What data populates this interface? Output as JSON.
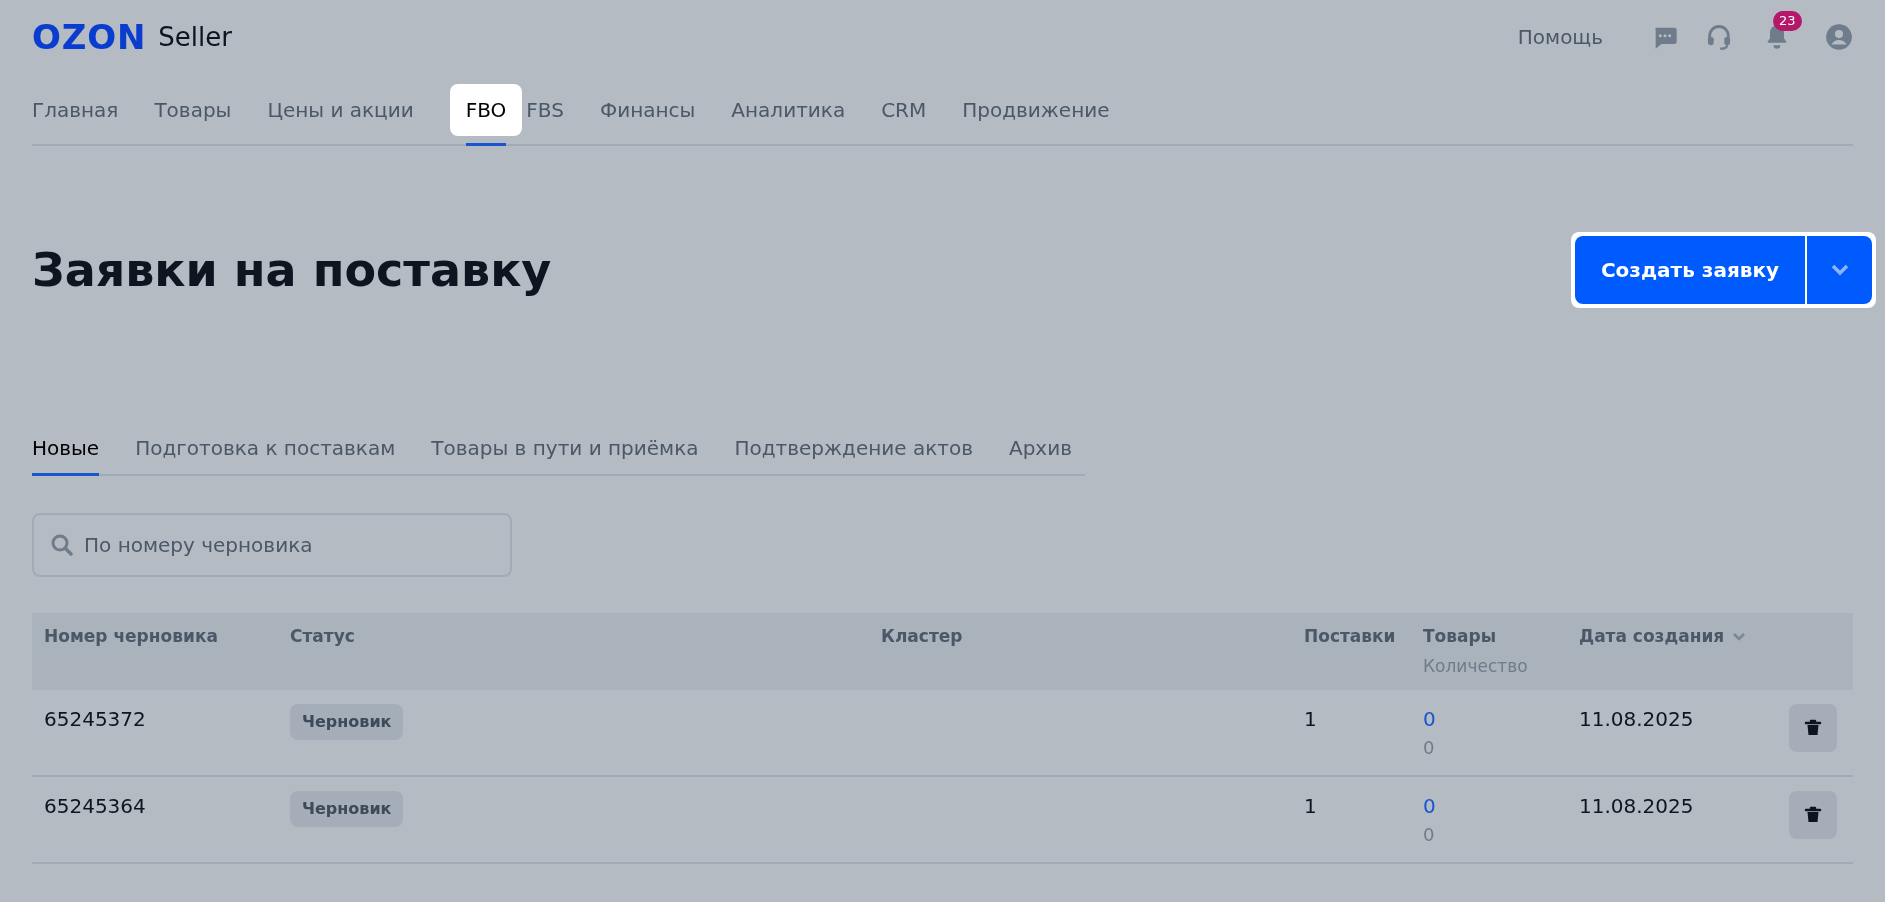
{
  "header": {
    "logo": "OZON",
    "logo_suffix": "Seller",
    "help": "Помощь",
    "notifications_badge": "23"
  },
  "nav": [
    {
      "label": "Главная",
      "selected": false
    },
    {
      "label": "Товары",
      "selected": false
    },
    {
      "label": "Цены и акции",
      "selected": false
    },
    {
      "label": "FBO",
      "selected": true
    },
    {
      "label": "FBS",
      "selected": false
    },
    {
      "label": "Финансы",
      "selected": false
    },
    {
      "label": "Аналитика",
      "selected": false
    },
    {
      "label": "CRM",
      "selected": false
    },
    {
      "label": "Продвижение",
      "selected": false
    }
  ],
  "page": {
    "title": "Заявки на поставку",
    "create_button": "Создать заявку"
  },
  "subtabs": [
    {
      "label": "Новые",
      "selected": true
    },
    {
      "label": "Подготовка к поставкам",
      "selected": false
    },
    {
      "label": "Товары в пути и приёмка",
      "selected": false
    },
    {
      "label": "Подтверждение актов",
      "selected": false
    },
    {
      "label": "Архив",
      "selected": false
    }
  ],
  "search": {
    "placeholder": "По номеру черновика"
  },
  "table": {
    "columns": [
      "Номер черновика",
      "Статус",
      "Кластер",
      "Поставки",
      "Товары",
      "Дата создания"
    ],
    "columns_sub": {
      "goods": "Количество"
    },
    "rows": [
      {
        "number": "65245372",
        "status": "Черновик",
        "shipments": "1",
        "goods": "0",
        "quantity": "0",
        "date": "11.08.2025"
      },
      {
        "number": "65245364",
        "status": "Черновик",
        "shipments": "1",
        "goods": "0",
        "quantity": "0",
        "date": "11.08.2025"
      }
    ]
  }
}
